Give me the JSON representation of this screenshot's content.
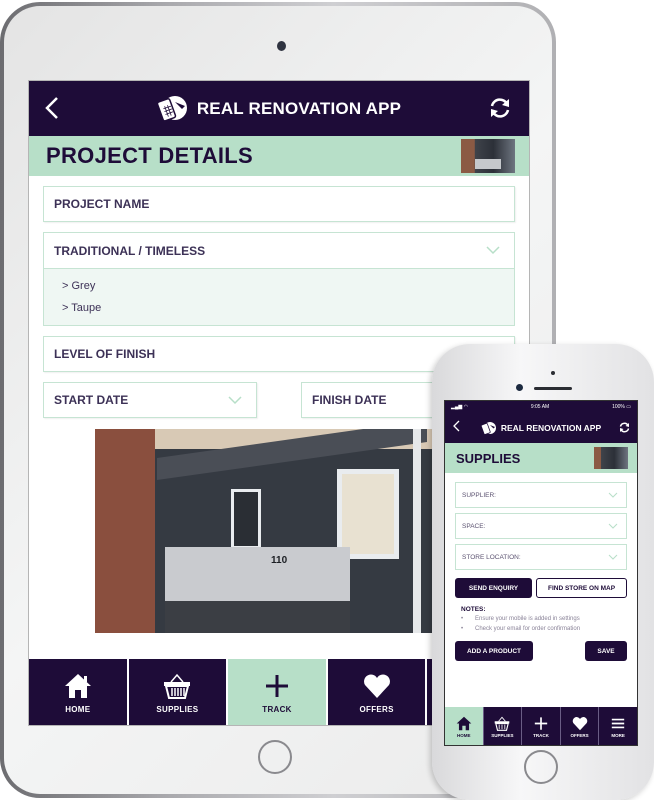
{
  "colors": {
    "brand_dark": "#1e0c38",
    "brand_mint": "#b7dfc8",
    "option_bg": "#eff7f3",
    "field_border": "#c6e4d3"
  },
  "tablet": {
    "header": {
      "title": "REAL RENOVATION APP",
      "back_icon": "chevron-left-icon",
      "refresh_icon": "refresh-icon",
      "logo_icon": "app-logo-icon"
    },
    "subheader": {
      "title": "PROJECT DETAILS"
    },
    "form": {
      "project_name_placeholder": "PROJECT NAME",
      "style_dropdown": {
        "selected": "TRADITIONAL / TIMELESS",
        "options": [
          "> Grey",
          "> Taupe"
        ]
      },
      "level_of_finish": "LEVEL OF FINISH",
      "start_date": "START DATE",
      "finish_date": "FINISH DATE"
    },
    "photo": {
      "house_number": "110"
    },
    "nav": [
      {
        "label": "HOME",
        "icon": "home-icon",
        "active": false
      },
      {
        "label": "SUPPLIES",
        "icon": "basket-icon",
        "active": false
      },
      {
        "label": "TRACK",
        "icon": "plus-icon",
        "active": true
      },
      {
        "label": "OFFERS",
        "icon": "heart-icon",
        "active": false
      }
    ]
  },
  "phone": {
    "status": {
      "time": "9:05 AM",
      "battery": "100%"
    },
    "header": {
      "title": "REAL RENOVATION APP"
    },
    "subheader": {
      "title": "SUPPLIES"
    },
    "form": {
      "supplier": "SUPPLIER:",
      "space": "SPACE:",
      "store_location": "STORE LOCATION:"
    },
    "buttons": {
      "send_enquiry": "SEND ENQUIRY",
      "find_store": "FIND STORE ON MAP",
      "add_product": "ADD A PRODUCT",
      "save": "SAVE"
    },
    "notes": {
      "title": "NOTES:",
      "items": [
        "Ensure your mobile is added in settings",
        "Check your email for order confirmation"
      ]
    },
    "nav": [
      {
        "label": "HOME",
        "icon": "home-icon",
        "active": true
      },
      {
        "label": "SUPPLIES",
        "icon": "basket-icon",
        "active": false
      },
      {
        "label": "TRACK",
        "icon": "plus-icon",
        "active": false
      },
      {
        "label": "OFFERS",
        "icon": "heart-icon",
        "active": false
      },
      {
        "label": "MORE",
        "icon": "menu-icon",
        "active": false
      }
    ]
  }
}
